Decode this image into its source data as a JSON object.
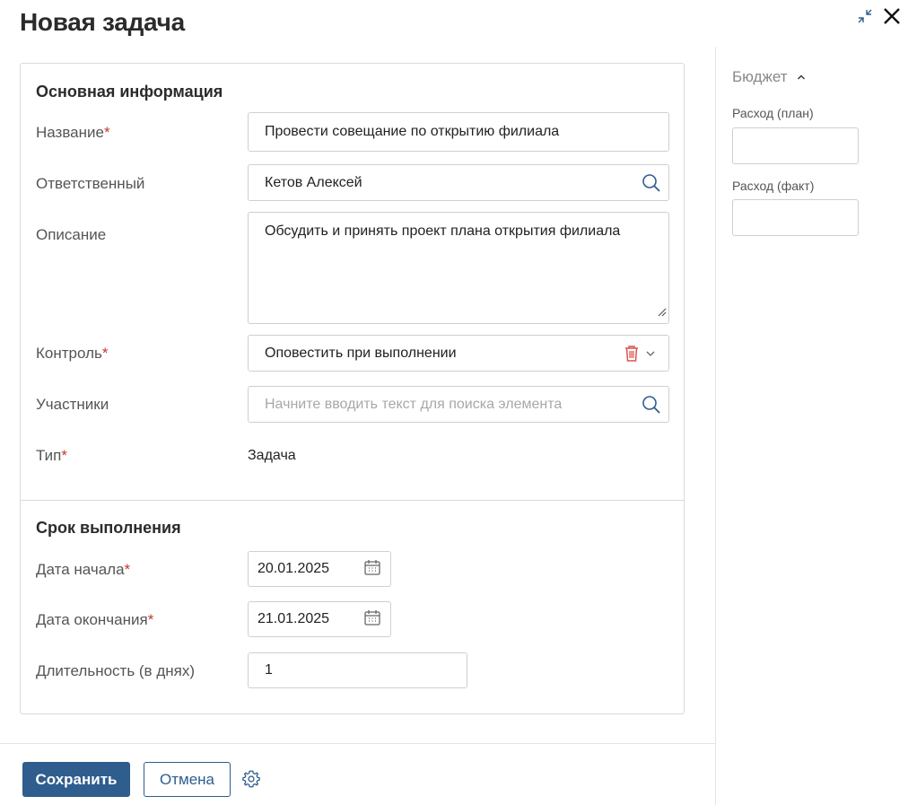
{
  "dialog": {
    "title": "Новая задача"
  },
  "sections": {
    "main": {
      "heading": "Основная информация",
      "fields": {
        "name": {
          "label": "Название",
          "value": "Провести совещание по открытию филиала"
        },
        "assignee": {
          "label": "Ответственный",
          "value": "Кетов Алексей"
        },
        "description": {
          "label": "Описание",
          "value": "Обсудить и принять проект плана открытия филиала"
        },
        "control": {
          "label": "Контроль",
          "value": "Оповестить при выполнении"
        },
        "participants": {
          "label": "Участники",
          "placeholder": "Начните вводить текст для поиска элемента"
        },
        "type": {
          "label": "Тип",
          "value": "Задача"
        }
      }
    },
    "deadline": {
      "heading": "Срок выполнения",
      "fields": {
        "start": {
          "label": "Дата начала",
          "value": "20.01.2025"
        },
        "end": {
          "label": "Дата окончания",
          "value": "21.01.2025"
        },
        "duration": {
          "label": "Длительность (в днях)",
          "value": "1"
        }
      }
    }
  },
  "budget": {
    "header": "Бюджет",
    "plan_label": "Расход (план)",
    "fact_label": "Расход (факт)"
  },
  "footer": {
    "save_label": "Сохранить",
    "cancel_label": "Отмена"
  },
  "required_marker": "*",
  "colors": {
    "accent": "#2e5d8e",
    "required": "#c0392b",
    "delete": "#d9534f"
  }
}
